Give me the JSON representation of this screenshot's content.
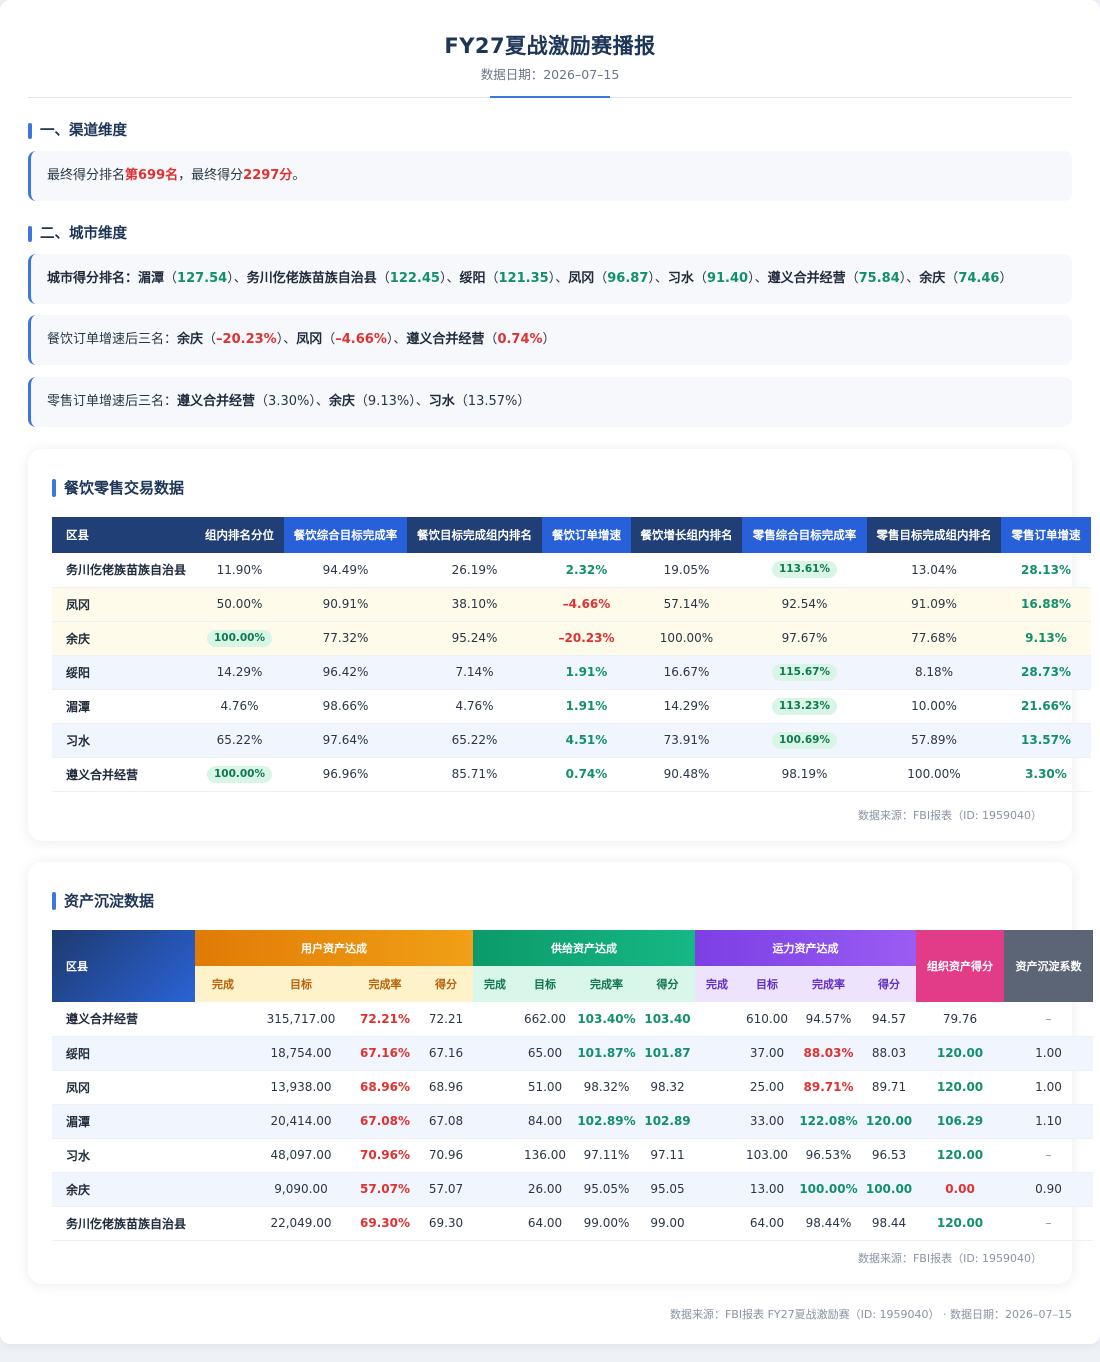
{
  "header": {
    "title": "FY27夏战激励赛播报",
    "date_label": "数据日期：2026–07–15"
  },
  "section1": {
    "title": "一、渠道维度",
    "rank_prefix": "最终得分排名",
    "rank_value": "第699名",
    "score_prefix": "，最终得分",
    "score_value": "2297分",
    "score_suffix": "。"
  },
  "section2": {
    "title": "二、城市维度",
    "city_rank": {
      "label": "城市得分排名：",
      "items": [
        {
          "name": "湄潭",
          "value": "127.54"
        },
        {
          "name": "务川仡佬族苗族自治县",
          "value": "122.45"
        },
        {
          "name": "绥阳",
          "value": "121.35"
        },
        {
          "name": "凤冈",
          "value": "96.87"
        },
        {
          "name": "习水",
          "value": "91.40"
        },
        {
          "name": "遵义合并经营",
          "value": "75.84"
        },
        {
          "name": "余庆",
          "value": "74.46"
        }
      ]
    },
    "catering_bottom": {
      "label": "餐饮订单增速后三名：",
      "items": [
        {
          "name": "余庆",
          "value": "–20.23%",
          "tone": "red"
        },
        {
          "name": "凤冈",
          "value": "–4.66%",
          "tone": "red"
        },
        {
          "name": "遵义合并经营",
          "value": "0.74%",
          "tone": "red"
        }
      ]
    },
    "retail_bottom": {
      "label": "零售订单增速后三名：",
      "items": [
        {
          "name": "遵义合并经营",
          "value": "3.30%",
          "tone": "plain"
        },
        {
          "name": "余庆",
          "value": "9.13%",
          "tone": "plain"
        },
        {
          "name": "习水",
          "value": "13.57%",
          "tone": "plain"
        }
      ]
    }
  },
  "trade": {
    "title": "餐饮零售交易数据",
    "headers": [
      "区县",
      "组内排名分位",
      "餐饮综合目标完成率",
      "餐饮目标完成组内排名",
      "餐饮订单增速",
      "餐饮增长组内排名",
      "零售综合目标完成率",
      "零售目标完成组内排名",
      "零售订单增速"
    ],
    "rows": [
      {
        "style": "",
        "cells": [
          "务川仡佬族苗族自治县",
          "11.90%",
          "94.49%",
          "26.19%",
          "2.32%",
          "19.05%",
          "113.61%",
          "13.04%",
          "28.13%"
        ],
        "fmt": [
          "",
          "",
          "",
          "",
          "gr",
          "",
          "pill",
          "",
          "gr"
        ]
      },
      {
        "style": "yellow",
        "cells": [
          "凤冈",
          "50.00%",
          "90.91%",
          "38.10%",
          "–4.66%",
          "57.14%",
          "92.54%",
          "91.09%",
          "16.88%"
        ],
        "fmt": [
          "",
          "",
          "",
          "",
          "rd",
          "",
          "",
          "",
          "gr"
        ]
      },
      {
        "style": "yellow",
        "cells": [
          "余庆",
          "100.00%",
          "77.32%",
          "95.24%",
          "–20.23%",
          "100.00%",
          "97.67%",
          "77.68%",
          "9.13%"
        ],
        "fmt": [
          "",
          "pill",
          "",
          "",
          "rd",
          "",
          "",
          "",
          "gr"
        ]
      },
      {
        "style": "blue",
        "cells": [
          "绥阳",
          "14.29%",
          "96.42%",
          "7.14%",
          "1.91%",
          "16.67%",
          "115.67%",
          "8.18%",
          "28.73%"
        ],
        "fmt": [
          "",
          "",
          "",
          "",
          "gr",
          "",
          "pill",
          "",
          "gr"
        ]
      },
      {
        "style": "",
        "cells": [
          "湄潭",
          "4.76%",
          "98.66%",
          "4.76%",
          "1.91%",
          "14.29%",
          "113.23%",
          "10.00%",
          "21.66%"
        ],
        "fmt": [
          "",
          "",
          "",
          "",
          "gr",
          "",
          "pill",
          "",
          "gr"
        ]
      },
      {
        "style": "blue",
        "cells": [
          "习水",
          "65.22%",
          "97.64%",
          "65.22%",
          "4.51%",
          "73.91%",
          "100.69%",
          "57.89%",
          "13.57%"
        ],
        "fmt": [
          "",
          "",
          "",
          "",
          "gr",
          "",
          "pill",
          "",
          "gr"
        ]
      },
      {
        "style": "",
        "cells": [
          "遵义合并经营",
          "100.00%",
          "96.96%",
          "85.71%",
          "0.74%",
          "90.48%",
          "98.19%",
          "100.00%",
          "3.30%"
        ],
        "fmt": [
          "",
          "pill",
          "",
          "",
          "gr",
          "",
          "",
          "",
          "gr"
        ]
      }
    ],
    "source": "数据来源：FBI报表（ID: 1959040）"
  },
  "asset": {
    "title": "资产沉淀数据",
    "h_name": "区县",
    "h_user": "用户资产达成",
    "h_sup": "供给资产达成",
    "h_cap": "运力资产达成",
    "h_org": "组织资产得分",
    "h_coef": "资产沉淀系数",
    "sub": [
      "完成",
      "目标",
      "完成率",
      "得分"
    ],
    "rows": [
      {
        "style": "",
        "cells": [
          "遵义合并经营",
          "",
          "315,717.00",
          "72.21%",
          "72.21",
          "",
          "662.00",
          "103.40%",
          "103.40",
          "",
          "610.00",
          "94.57%",
          "94.57",
          "79.76",
          "–"
        ],
        "fmt": [
          "",
          "",
          "",
          "rd",
          "",
          "",
          "",
          "gr",
          "gr",
          "",
          "",
          "",
          "",
          "",
          "muted"
        ]
      },
      {
        "style": "blue",
        "cells": [
          "绥阳",
          "",
          "18,754.00",
          "67.16%",
          "67.16",
          "",
          "65.00",
          "101.87%",
          "101.87",
          "",
          "37.00",
          "88.03%",
          "88.03",
          "120.00",
          "1.00"
        ],
        "fmt": [
          "",
          "",
          "",
          "rd",
          "",
          "",
          "",
          "gr",
          "gr",
          "",
          "",
          "rd",
          "",
          "gr",
          ""
        ]
      },
      {
        "style": "",
        "cells": [
          "凤冈",
          "",
          "13,938.00",
          "68.96%",
          "68.96",
          "",
          "51.00",
          "98.32%",
          "98.32",
          "",
          "25.00",
          "89.71%",
          "89.71",
          "120.00",
          "1.00"
        ],
        "fmt": [
          "",
          "",
          "",
          "rd",
          "",
          "",
          "",
          "",
          "",
          "",
          "",
          "rd",
          "",
          "gr",
          ""
        ]
      },
      {
        "style": "blue",
        "cells": [
          "湄潭",
          "",
          "20,414.00",
          "67.08%",
          "67.08",
          "",
          "84.00",
          "102.89%",
          "102.89",
          "",
          "33.00",
          "122.08%",
          "120.00",
          "106.29",
          "1.10"
        ],
        "fmt": [
          "",
          "",
          "",
          "rd",
          "",
          "",
          "",
          "gr",
          "gr",
          "",
          "",
          "gr",
          "gr",
          "gr",
          ""
        ]
      },
      {
        "style": "",
        "cells": [
          "习水",
          "",
          "48,097.00",
          "70.96%",
          "70.96",
          "",
          "136.00",
          "97.11%",
          "97.11",
          "",
          "103.00",
          "96.53%",
          "96.53",
          "120.00",
          "–"
        ],
        "fmt": [
          "",
          "",
          "",
          "rd",
          "",
          "",
          "",
          "",
          "",
          "",
          "",
          "",
          "",
          "gr",
          "muted"
        ]
      },
      {
        "style": "blue",
        "cells": [
          "余庆",
          "",
          "9,090.00",
          "57.07%",
          "57.07",
          "",
          "26.00",
          "95.05%",
          "95.05",
          "",
          "13.00",
          "100.00%",
          "100.00",
          "0.00",
          "0.90"
        ],
        "fmt": [
          "",
          "",
          "",
          "rd",
          "",
          "",
          "",
          "",
          "",
          "",
          "",
          "gr",
          "gr",
          "rd",
          ""
        ]
      },
      {
        "style": "",
        "cells": [
          "务川仡佬族苗族自治县",
          "",
          "22,049.00",
          "69.30%",
          "69.30",
          "",
          "64.00",
          "99.00%",
          "99.00",
          "",
          "64.00",
          "98.44%",
          "98.44",
          "120.00",
          "–"
        ],
        "fmt": [
          "",
          "",
          "",
          "rd",
          "",
          "",
          "",
          "",
          "",
          "",
          "",
          "",
          "",
          "gr",
          "muted"
        ]
      }
    ],
    "source": "数据来源：FBI报表（ID: 1959040）"
  },
  "footer": "数据来源：FBI报表 FY27夏战激励赛（ID: 1959040） · 数据日期：2026–07–15"
}
